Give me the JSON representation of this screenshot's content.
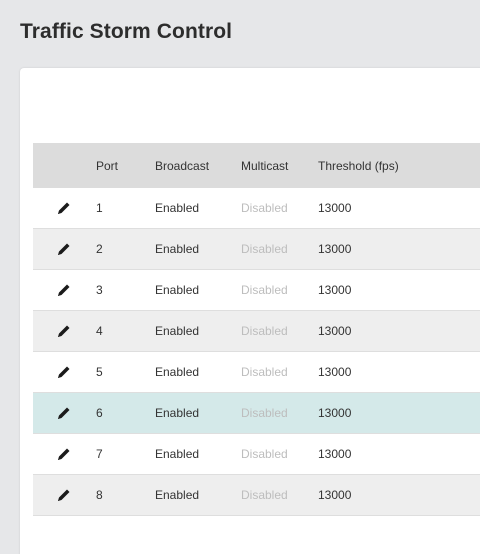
{
  "page": {
    "title": "Traffic Storm Control"
  },
  "table": {
    "columns": [
      "Port",
      "Broadcast",
      "Multicast",
      "Threshold (fps)"
    ],
    "rows": [
      {
        "port": "1",
        "broadcast": "Enabled",
        "multicast": "Disabled",
        "threshold": "13000"
      },
      {
        "port": "2",
        "broadcast": "Enabled",
        "multicast": "Disabled",
        "threshold": "13000"
      },
      {
        "port": "3",
        "broadcast": "Enabled",
        "multicast": "Disabled",
        "threshold": "13000"
      },
      {
        "port": "4",
        "broadcast": "Enabled",
        "multicast": "Disabled",
        "threshold": "13000"
      },
      {
        "port": "5",
        "broadcast": "Enabled",
        "multicast": "Disabled",
        "threshold": "13000"
      },
      {
        "port": "6",
        "broadcast": "Enabled",
        "multicast": "Disabled",
        "threshold": "13000"
      },
      {
        "port": "7",
        "broadcast": "Enabled",
        "multicast": "Disabled",
        "threshold": "13000"
      },
      {
        "port": "8",
        "broadcast": "Enabled",
        "multicast": "Disabled",
        "threshold": "13000"
      }
    ],
    "selected_row_index": 5,
    "row_action_icon": "pencil-edit-icon"
  },
  "colors": {
    "header_bg": "#dcdcdc",
    "alt_row_bg": "#eeeeee",
    "selected_row_bg": "#d4e9e9",
    "disabled_text": "#bdbdbd"
  }
}
